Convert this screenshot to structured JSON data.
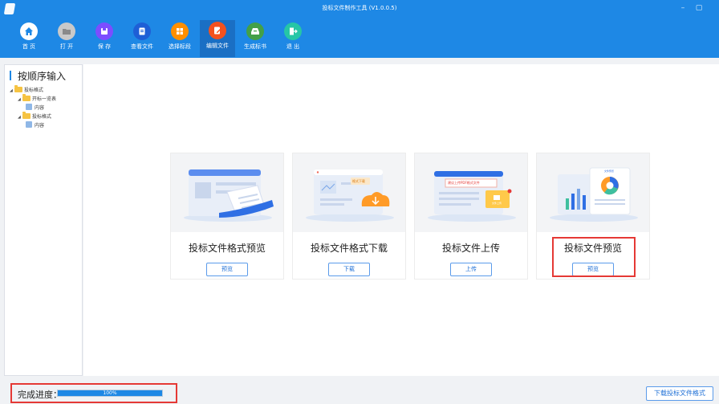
{
  "window": {
    "title": "投标文件制作工具 (V1.0.0.5)",
    "minimize_symbol": "–",
    "maximize_symbol": "▢"
  },
  "toolbar": {
    "items": [
      {
        "label": "首 页",
        "icon": "home-icon",
        "color": "#ffffff"
      },
      {
        "label": "打 开",
        "icon": "folder-icon",
        "color": "#c9c9c9"
      },
      {
        "label": "保 存",
        "icon": "save-icon",
        "color": "#7c4dff"
      },
      {
        "label": "查看文件",
        "icon": "document-icon",
        "color": "#1e5fd6"
      },
      {
        "label": "选择标段",
        "icon": "grid-icon",
        "color": "#ff8f00"
      },
      {
        "label": "编辑文件",
        "icon": "edit-icon",
        "color": "#f4511e",
        "active": true
      },
      {
        "label": "生成标书",
        "icon": "tray-icon",
        "color": "#43a047"
      },
      {
        "label": "退 出",
        "icon": "exit-icon",
        "color": "#26c6a6"
      }
    ]
  },
  "sidebar": {
    "title": "按顺序输入",
    "tree": [
      {
        "label": "投标格式",
        "type": "folder",
        "level": 0,
        "expanded": true
      },
      {
        "label": "开标一览表",
        "type": "folder",
        "level": 1,
        "expanded": true
      },
      {
        "label": "内容",
        "type": "doc",
        "level": 2
      },
      {
        "label": "投标格式",
        "type": "folder",
        "level": 1,
        "expanded": true
      },
      {
        "label": "内容",
        "type": "doc",
        "level": 2
      }
    ],
    "expand_symbol": "◢"
  },
  "cards": [
    {
      "title": "投标文件格式预览",
      "button": "预览",
      "illustration": "document-preview-illustration"
    },
    {
      "title": "投标文件格式下载",
      "button": "下载",
      "illustration": "download-illustration",
      "art_tag": "格式下载"
    },
    {
      "title": "投标文件上传",
      "button": "上传",
      "illustration": "upload-illustration",
      "art_note": "建议上传PDF格式文件",
      "art_tag": "文件上传"
    },
    {
      "title": "投标文件预览",
      "button": "预览",
      "illustration": "chart-preview-illustration",
      "art_tag": "文件预览",
      "highlighted": true
    }
  ],
  "bottom": {
    "progress_label": "完成进度：",
    "progress_value": 100,
    "progress_text": "100%",
    "download_button": "下载投标文件格式"
  },
  "colors": {
    "brand": "#1e88e5",
    "highlight": "#e53935"
  }
}
